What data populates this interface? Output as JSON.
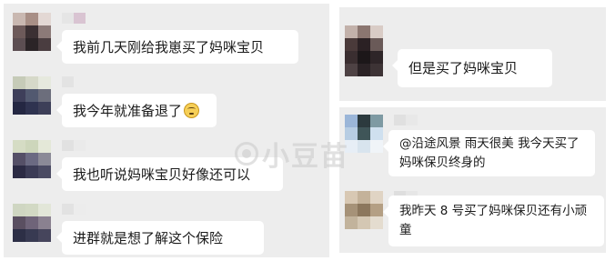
{
  "left_panel": {
    "messages": [
      {
        "text": "我前几天刚给我崽买了妈咪宝贝"
      },
      {
        "text": "我今年就准备退了",
        "emoji": "awkward-smile-emoji"
      },
      {
        "text": "我也听说妈咪宝贝好像还可以"
      },
      {
        "text": "进群就是想了解这个保险"
      }
    ]
  },
  "right_top": {
    "message": {
      "text": "但是买了妈咪宝贝"
    }
  },
  "right_bottom": {
    "messages": [
      {
        "lines": [
          "@沿途风景 雨天很美  我今天买了",
          "妈咪保贝终身的"
        ]
      },
      {
        "lines": [
          "我昨天 8 号买了妈咪保贝还有小顽",
          "童"
        ]
      }
    ]
  },
  "watermark": {
    "text": "小豆苗",
    "icon": "bean-logo-icon"
  },
  "colors": {
    "panel_bg": "#ededed",
    "bubble_bg": "#ffffff",
    "text": "#1a1a1a"
  }
}
